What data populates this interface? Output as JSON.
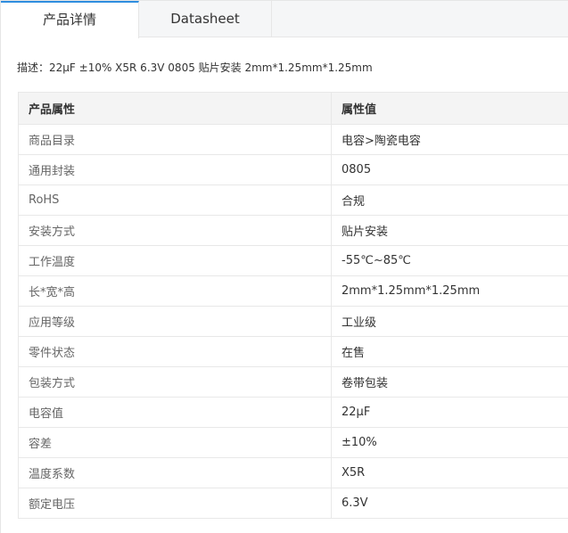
{
  "tabs": [
    {
      "label": "产品详情",
      "active": true
    },
    {
      "label": "Datasheet",
      "active": false
    }
  ],
  "description": {
    "label": "描述：",
    "text": "22μF ±10% X5R 6.3V 0805 贴片安装 2mm*1.25mm*1.25mm"
  },
  "table": {
    "headers": [
      "产品属性",
      "属性值"
    ],
    "rows": [
      {
        "name": "商品目录",
        "value": "电容>陶瓷电容"
      },
      {
        "name": "通用封装",
        "value": "0805"
      },
      {
        "name": "RoHS",
        "value": "合规"
      },
      {
        "name": "安装方式",
        "value": "贴片安装"
      },
      {
        "name": "工作温度",
        "value": "-55℃~85℃"
      },
      {
        "name": "长*宽*高",
        "value": "2mm*1.25mm*1.25mm"
      },
      {
        "name": "应用等级",
        "value": "工业级"
      },
      {
        "name": "零件状态",
        "value": "在售"
      },
      {
        "name": "包装方式",
        "value": "卷带包装"
      },
      {
        "name": "电容值",
        "value": "22μF"
      },
      {
        "name": "容差",
        "value": "±10%"
      },
      {
        "name": "温度系数",
        "value": "X5R"
      },
      {
        "name": "额定电压",
        "value": "6.3V"
      }
    ]
  },
  "colors": {
    "active_tab_accent": "#2e8ddf",
    "tabbar_background": "#f5f6f7",
    "table_header_background": "#f4f4f4",
    "border": "#e8e8e8"
  }
}
